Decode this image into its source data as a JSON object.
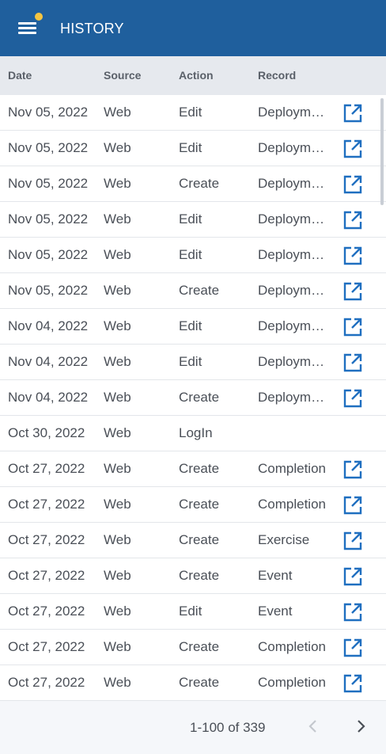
{
  "header": {
    "title": "HISTORY",
    "menu_icon": "menu-icon",
    "notification_color": "#f4c542"
  },
  "table": {
    "columns": {
      "date": "Date",
      "source": "Source",
      "action": "Action",
      "record": "Record"
    },
    "rows": [
      {
        "date": "Nov 05, 2022",
        "source": "Web",
        "action": "Edit",
        "record": "Deployme…",
        "has_link": true
      },
      {
        "date": "Nov 05, 2022",
        "source": "Web",
        "action": "Edit",
        "record": "Deployme…",
        "has_link": true
      },
      {
        "date": "Nov 05, 2022",
        "source": "Web",
        "action": "Create",
        "record": "Deployme…",
        "has_link": true
      },
      {
        "date": "Nov 05, 2022",
        "source": "Web",
        "action": "Edit",
        "record": "Deployme…",
        "has_link": true
      },
      {
        "date": "Nov 05, 2022",
        "source": "Web",
        "action": "Edit",
        "record": "Deployme…",
        "has_link": true
      },
      {
        "date": "Nov 05, 2022",
        "source": "Web",
        "action": "Create",
        "record": "Deployme…",
        "has_link": true
      },
      {
        "date": "Nov 04, 2022",
        "source": "Web",
        "action": "Edit",
        "record": "Deployme…",
        "has_link": true
      },
      {
        "date": "Nov 04, 2022",
        "source": "Web",
        "action": "Edit",
        "record": "Deployme…",
        "has_link": true
      },
      {
        "date": "Nov 04, 2022",
        "source": "Web",
        "action": "Create",
        "record": "Deployme…",
        "has_link": true
      },
      {
        "date": "Oct 30, 2022",
        "source": "Web",
        "action": "LogIn",
        "record": "",
        "has_link": false
      },
      {
        "date": "Oct 27, 2022",
        "source": "Web",
        "action": "Create",
        "record": "Completion",
        "has_link": true
      },
      {
        "date": "Oct 27, 2022",
        "source": "Web",
        "action": "Create",
        "record": "Completion",
        "has_link": true
      },
      {
        "date": "Oct 27, 2022",
        "source": "Web",
        "action": "Create",
        "record": "Exercise",
        "has_link": true
      },
      {
        "date": "Oct 27, 2022",
        "source": "Web",
        "action": "Create",
        "record": "Event",
        "has_link": true
      },
      {
        "date": "Oct 27, 2022",
        "source": "Web",
        "action": "Edit",
        "record": "Event",
        "has_link": true
      },
      {
        "date": "Oct 27, 2022",
        "source": "Web",
        "action": "Create",
        "record": "Completion",
        "has_link": true
      },
      {
        "date": "Oct 27, 2022",
        "source": "Web",
        "action": "Create",
        "record": "Completion",
        "has_link": true
      }
    ],
    "link_icon": "open-in-new-icon",
    "link_color": "#1f6fc0"
  },
  "pagination": {
    "range": "1-100 of 339",
    "prev_icon": "chevron-left-icon",
    "next_icon": "chevron-right-icon"
  }
}
